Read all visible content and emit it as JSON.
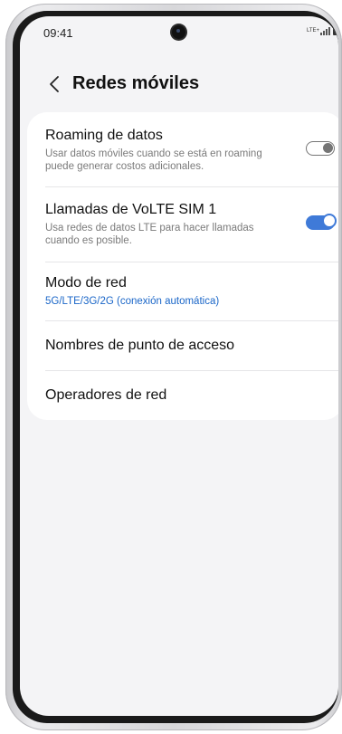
{
  "status_bar": {
    "time": "09:41",
    "network_label": "LTE+",
    "icons": [
      "camera-cutout",
      "lte-icon",
      "signal-icon",
      "battery-icon"
    ]
  },
  "header": {
    "back_icon": "chevron-left-icon",
    "title": "Redes móviles"
  },
  "settings": {
    "data_roaming": {
      "label": "Roaming de datos",
      "description": "Usar datos móviles cuando se está en roaming puede generar costos adicionales.",
      "enabled": false
    },
    "volte": {
      "label": "Llamadas de VoLTE SIM 1",
      "description": "Usa redes de datos LTE para hacer llamadas cuando es posible.",
      "enabled": true
    },
    "network_mode": {
      "label": "Modo de red",
      "value": "5G/LTE/3G/2G (conexión automática)"
    },
    "apn": {
      "label": "Nombres de punto de acceso"
    },
    "operators": {
      "label": "Operadores de red"
    }
  },
  "colors": {
    "accent": "#3f7ad8",
    "link_text": "#1a66c8",
    "background": "#f4f4f6",
    "card": "#ffffff"
  }
}
